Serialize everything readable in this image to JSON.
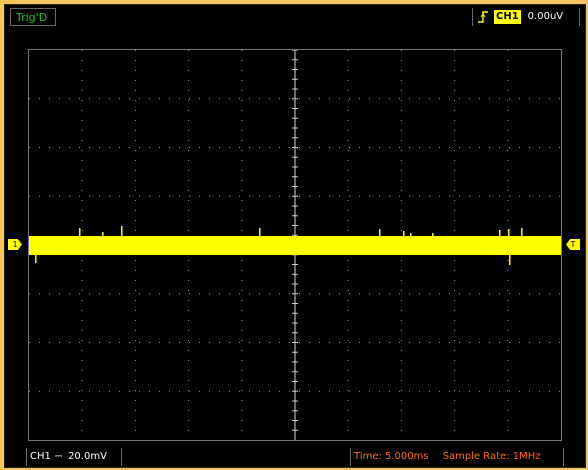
{
  "status": {
    "trigger_state": "Trig'D",
    "trigger_channel": "CH1",
    "trigger_level": "0.00uV",
    "channel_label": "CH1",
    "coupling_symbol": "⎓",
    "volts_div": "20.0mV",
    "time_base": "Time: 5.000ms",
    "sample_rate": "Sample Rate: 1MHz"
  },
  "markers": {
    "channel_marker": "1",
    "trigger_marker": "T"
  },
  "icons": {
    "edge": "rising-edge-icon"
  },
  "colors": {
    "background": "#f6c65e",
    "trace": "#ffff00",
    "trigger_state": "#21c321",
    "time_text": "#ff6a1a"
  }
}
